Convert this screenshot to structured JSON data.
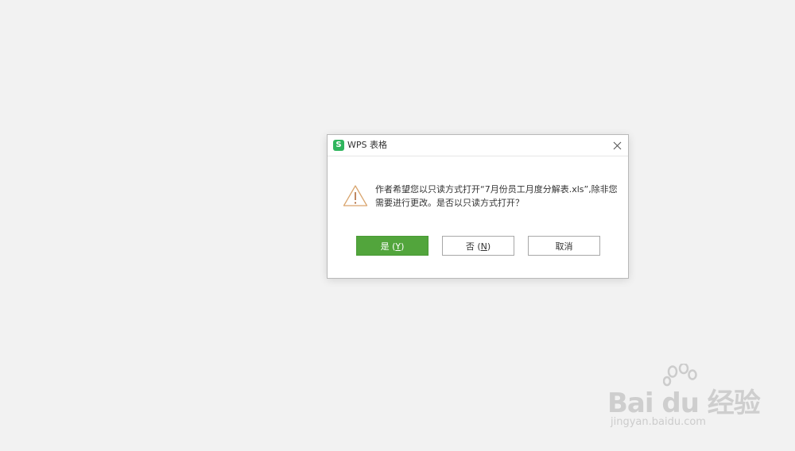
{
  "dialog": {
    "app_logo_letter": "S",
    "title": "WPS 表格",
    "message": "作者希望您以只读方式打开“7月份员工月度分解表.xls”,除非您需要进行更改。是否以只读方式打开？",
    "buttons": {
      "yes_label": "是 (",
      "yes_mnemonic": "Y",
      "yes_suffix": ")",
      "no_label": "否 (",
      "no_mnemonic": "N",
      "no_suffix": ")",
      "cancel_label": "取消"
    }
  },
  "watermark": {
    "brand": "Bai du 经验",
    "url": "jingyan.baidu.com"
  },
  "colors": {
    "background": "#f2f2f2",
    "logo_green": "#2fb55d",
    "primary_button": "#52a53c",
    "warning": "#d9a56e"
  }
}
